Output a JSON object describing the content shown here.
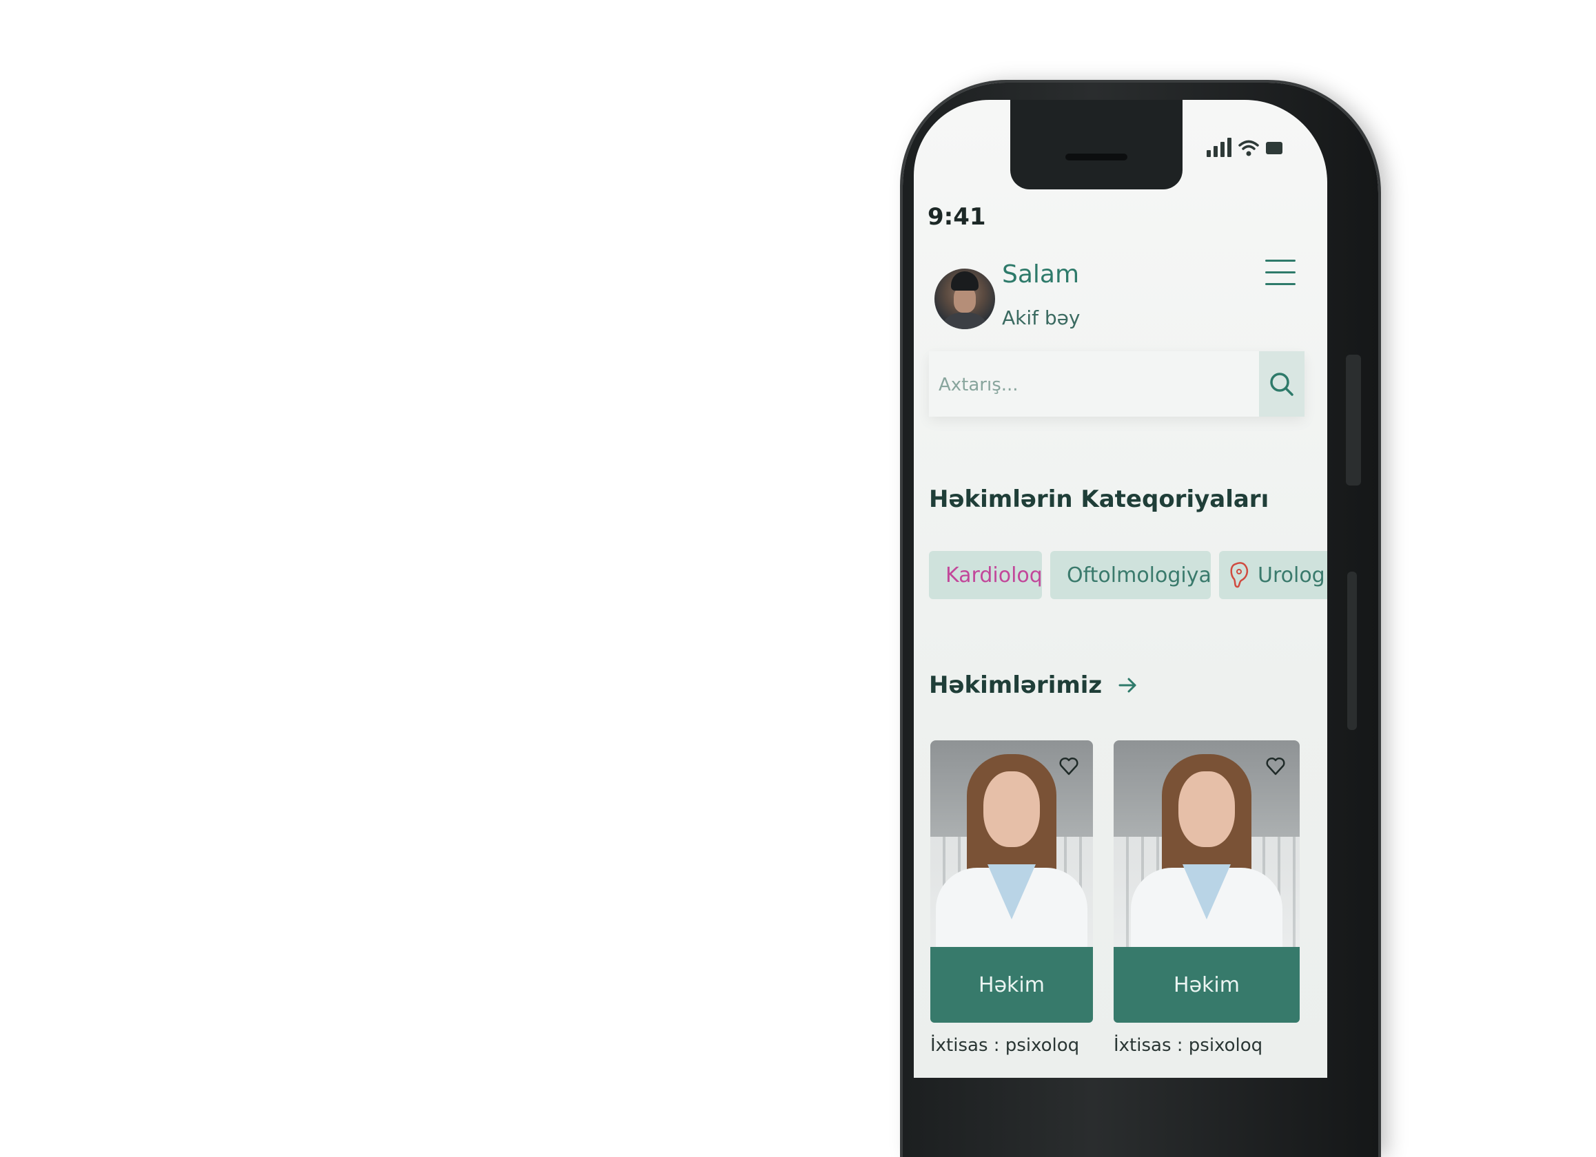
{
  "status_bar": {
    "time": "9:41"
  },
  "header": {
    "greeting": "Salam",
    "user_name": "Akif bəy"
  },
  "search": {
    "placeholder": "Axtarış..."
  },
  "categories": {
    "title": "Həkimlərin Kateqoriyaları",
    "items": [
      {
        "label": "Kardioloq",
        "icon": "heart-pulse-icon",
        "color": "#c2479a"
      },
      {
        "label": "Oftolmologiya",
        "icon": "eye-chart-icon",
        "color": "#3a7a6c"
      },
      {
        "label": "Urolog",
        "icon": "kidney-icon",
        "color": "#d04a3f"
      }
    ]
  },
  "doctors": {
    "title": "Həkimlərimiz",
    "cards": [
      {
        "role": "Həkim",
        "specialty": "İxtisas : psixoloq"
      },
      {
        "role": "Həkim",
        "specialty": "İxtisas : psixoloq"
      }
    ]
  },
  "colors": {
    "accent": "#377a6b",
    "chip_bg": "#cfe2dc",
    "cardio": "#c2479a"
  }
}
